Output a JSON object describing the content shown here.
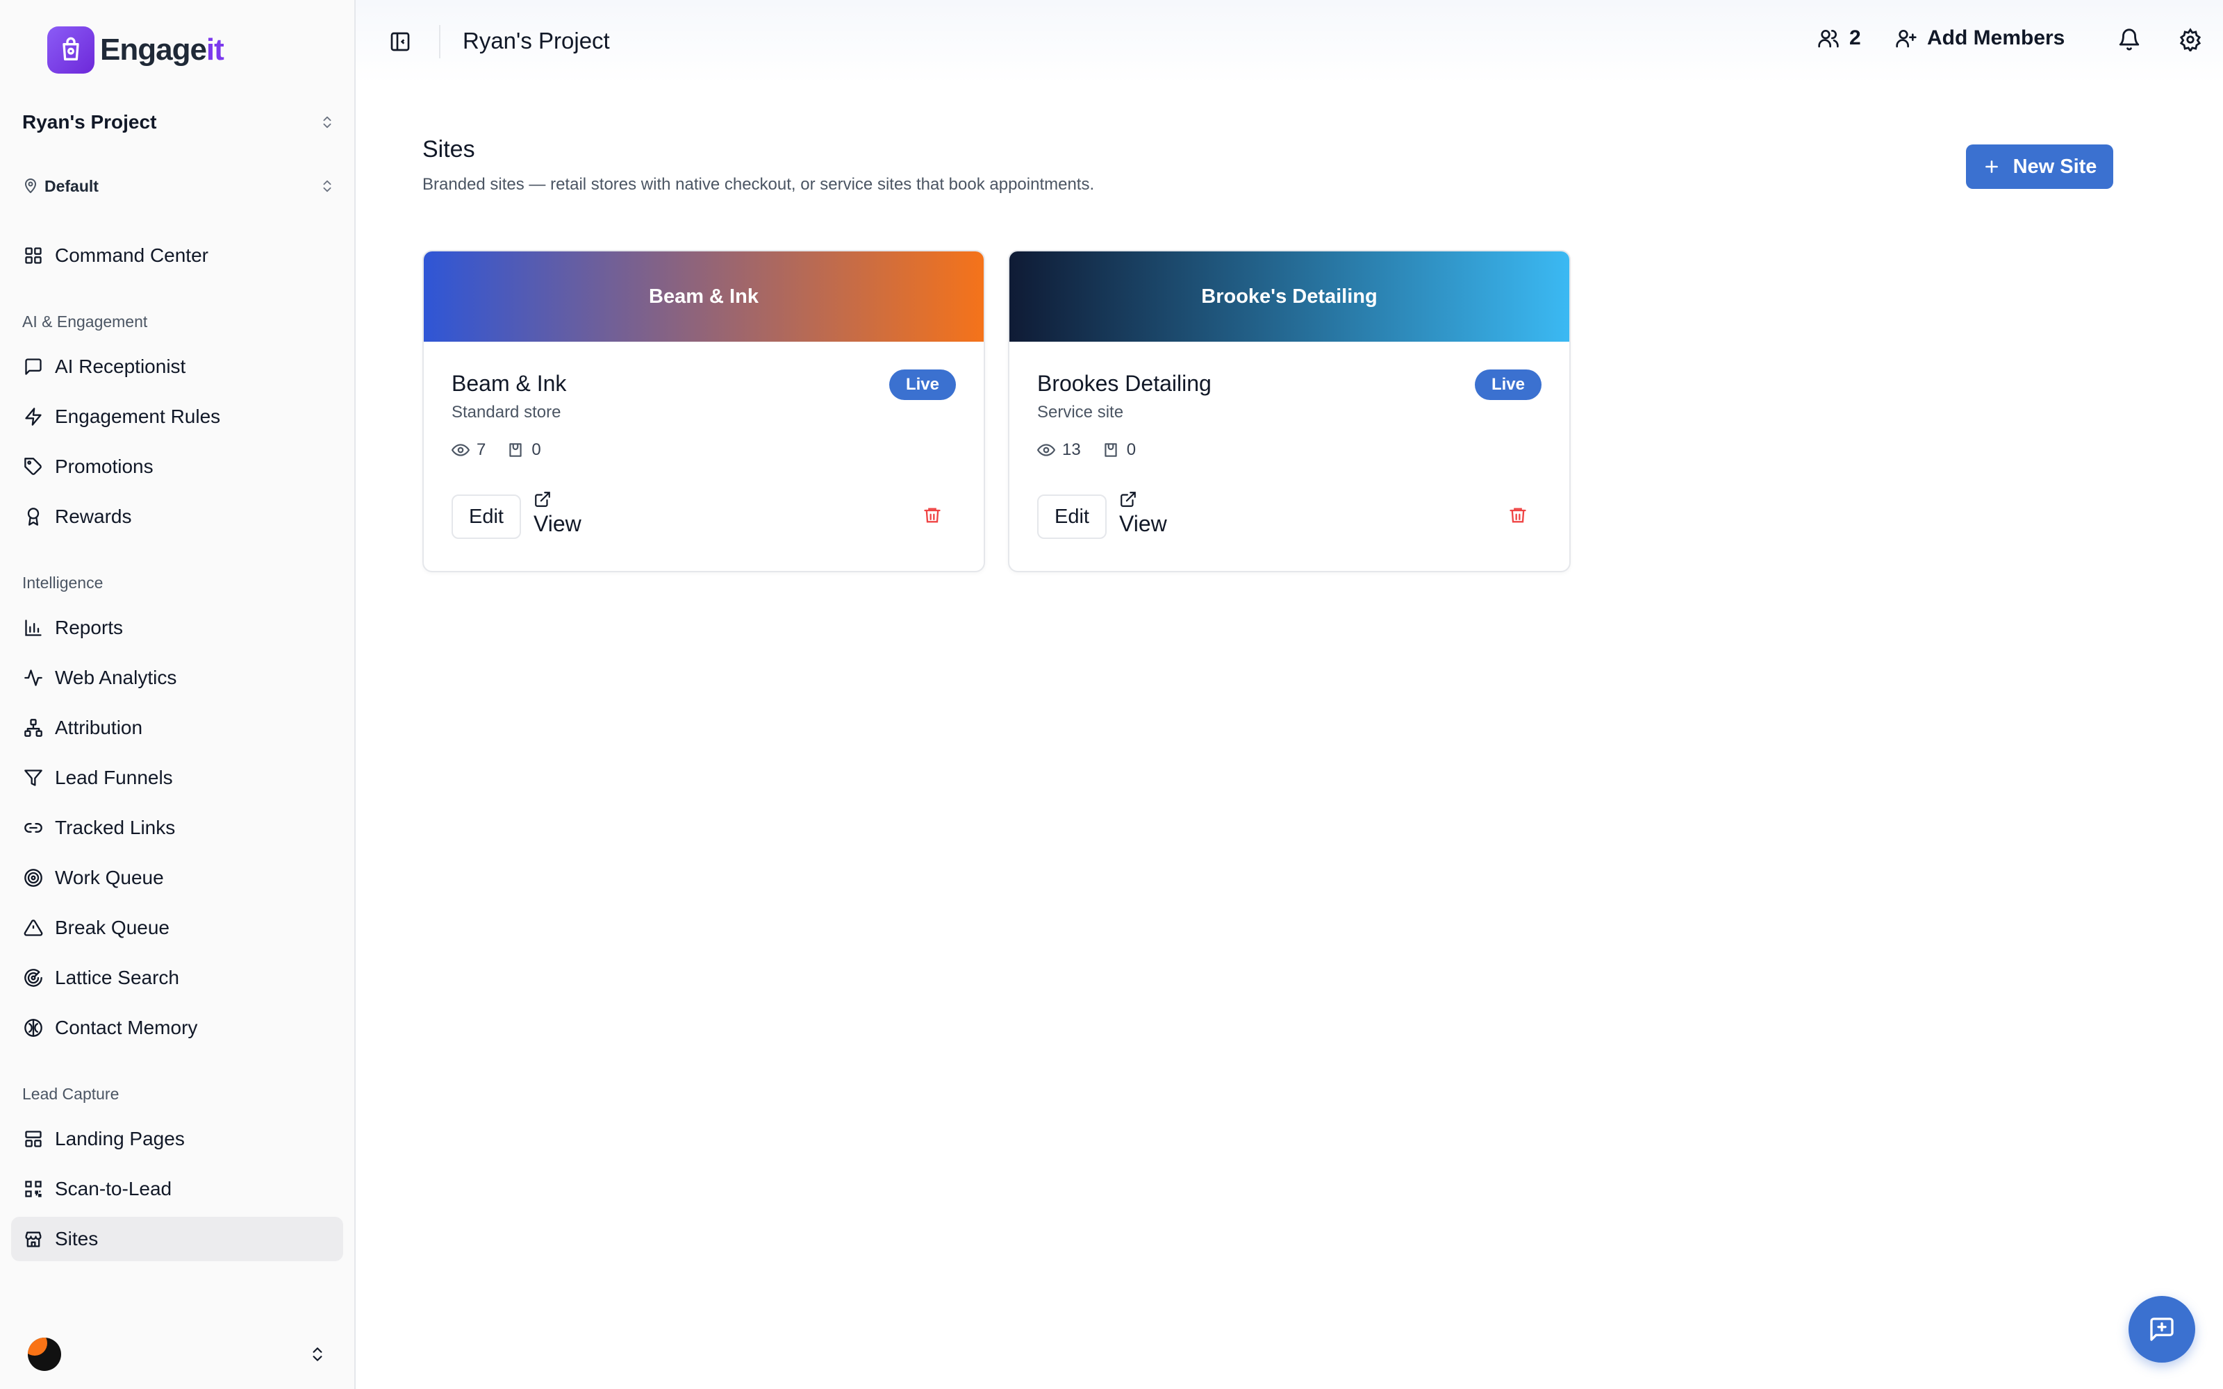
{
  "brand": {
    "name_part1": "Engage",
    "name_part2": "it"
  },
  "sidebar": {
    "project": "Ryan's Project",
    "location": "Default",
    "top_items": [
      {
        "label": "Command Center",
        "icon": "grid-icon"
      }
    ],
    "sections": [
      {
        "title": "AI & Engagement",
        "items": [
          {
            "label": "AI Receptionist",
            "icon": "message-square-icon"
          },
          {
            "label": "Engagement Rules",
            "icon": "zap-icon"
          },
          {
            "label": "Promotions",
            "icon": "tag-icon"
          },
          {
            "label": "Rewards",
            "icon": "award-icon"
          }
        ]
      },
      {
        "title": "Intelligence",
        "items": [
          {
            "label": "Reports",
            "icon": "bar-chart-icon"
          },
          {
            "label": "Web Analytics",
            "icon": "activity-icon"
          },
          {
            "label": "Attribution",
            "icon": "network-icon"
          },
          {
            "label": "Lead Funnels",
            "icon": "filter-icon"
          },
          {
            "label": "Tracked Links",
            "icon": "link-icon"
          },
          {
            "label": "Work Queue",
            "icon": "target-icon"
          },
          {
            "label": "Break Queue",
            "icon": "alert-triangle-icon"
          },
          {
            "label": "Lattice Search",
            "icon": "radar-icon"
          },
          {
            "label": "Contact Memory",
            "icon": "brain-icon"
          }
        ]
      },
      {
        "title": "Lead Capture",
        "items": [
          {
            "label": "Landing Pages",
            "icon": "layout-icon"
          },
          {
            "label": "Scan-to-Lead",
            "icon": "qr-code-icon"
          },
          {
            "label": "Sites",
            "icon": "store-icon",
            "active": true
          }
        ]
      }
    ]
  },
  "topbar": {
    "title": "Ryan's Project",
    "member_count": "2",
    "add_members_label": "Add Members"
  },
  "main": {
    "title": "Sites",
    "subtitle": "Branded sites — retail stores with native checkout, or service sites that book appointments.",
    "new_site_label": "New Site",
    "sites": [
      {
        "banner_title": "Beam & Ink",
        "name": "Beam & Ink",
        "type": "Standard store",
        "status": "Live",
        "views": "7",
        "orders": "0",
        "edit_label": "Edit",
        "view_label": "View",
        "gradient": [
          "#2f56d6",
          "#f5731a"
        ]
      },
      {
        "banner_title": "Brooke's Detailing",
        "name": "Brookes Detailing",
        "type": "Service site",
        "status": "Live",
        "views": "13",
        "orders": "0",
        "edit_label": "Edit",
        "view_label": "View",
        "gradient": [
          "#0f1b35",
          "#3bb9f3"
        ]
      }
    ]
  },
  "colors": {
    "accent": "#3b71d0",
    "brand": "#7c3aed",
    "danger": "#ef4444"
  }
}
